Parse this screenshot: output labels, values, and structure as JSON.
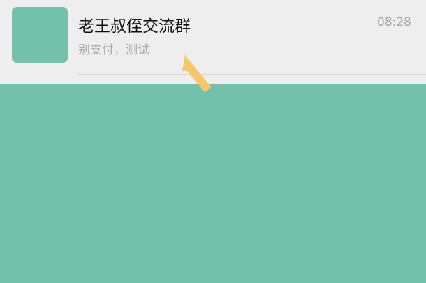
{
  "chat_item": {
    "name": "老王叔侄交流群",
    "preview": "别支付，测试",
    "time": "08:28"
  },
  "colors": {
    "accent": "#73c1aa",
    "row_background": "#eeeeee",
    "arrow": "#f7c56a"
  },
  "icons": {
    "annotation": "pointer-arrow-icon"
  }
}
